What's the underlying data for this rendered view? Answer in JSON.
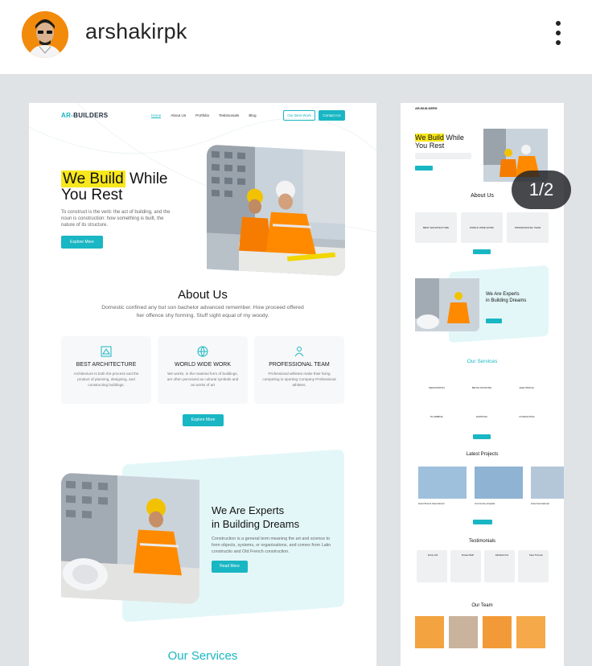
{
  "post_header": {
    "username": "arshakirpk",
    "avatar_icon": "profile-avatar",
    "menu_icon": "more-vertical-icon"
  },
  "carousel": {
    "indicator": "1/2"
  },
  "website": {
    "logo_prefix": "AR-",
    "logo_suffix": "BUILDERS",
    "nav": [
      "Home",
      "About Us",
      "Portfolio",
      "Testimonials",
      "Blog"
    ],
    "btn_outline": "Our Best Work",
    "btn_contact": "Contact Us",
    "hero": {
      "title_highlight": "We Build",
      "title_rest": " While",
      "title_line2": "You Rest",
      "text": "To construct is the verb: the act of building, and the noun is construction: how something is built, the nature of its structure.",
      "button": "Explore More"
    },
    "about": {
      "title": "About Us",
      "text": "Domestic confined any but son bachelor advanced remember. How proceed offered her offence shy forming. Stuff sight equal of my woody.",
      "cards": [
        {
          "title": "BEST ARCHITECTURE",
          "text": "Architecture is both the process and the product of planning, designing, and constructing buildings."
        },
        {
          "title": "WORLD WIDE WORK",
          "text": "We works, in the material form of buildings, are often perceived as cultural symbols and as works of art"
        },
        {
          "title": "PROFESSIONAL TEAM",
          "text": "Professional athletes make their living competing in sporting Company Professional athletes."
        }
      ],
      "button": "Explore More"
    },
    "experts": {
      "title_line1": "We Are Experts",
      "title_line2": "in Building Dreams",
      "text": "Construction is a general term meaning the art and science to form objects, systems, or organizations, and comes from Latin constructio and Old French construction.",
      "button": "Read More"
    },
    "services_title": "Our Services"
  },
  "page2": {
    "logo": "AR-BUILDERS",
    "hero_highlight": "We Build",
    "hero_rest": " While",
    "hero_line2": "You Rest",
    "about_title": "About Us",
    "about_cards": [
      "BEST ARCHITECTURE",
      "WORLD WIDE WORK",
      "PROFESSIONAL TEAM"
    ],
    "experts_line1": "We Are Experts",
    "experts_line2": "in Building Dreams",
    "services_title": "Our Services",
    "services": [
      "RENOVATION",
      "METAL ROOFING",
      "ELECTRICAL",
      "PLUMBING",
      "PAINTING",
      "CONSULTING"
    ],
    "projects_title": "Latest Projects",
    "projects": [
      "Hotel Shrook International",
      "Community Hospital",
      "Hotel International"
    ],
    "testimonials_title": "Testimonials",
    "testimonials": [
      "Emily Jeff",
      "Rowan Bath",
      "Elizabeth Fel",
      "Sara Thomas"
    ],
    "team_title": "Our Team"
  }
}
